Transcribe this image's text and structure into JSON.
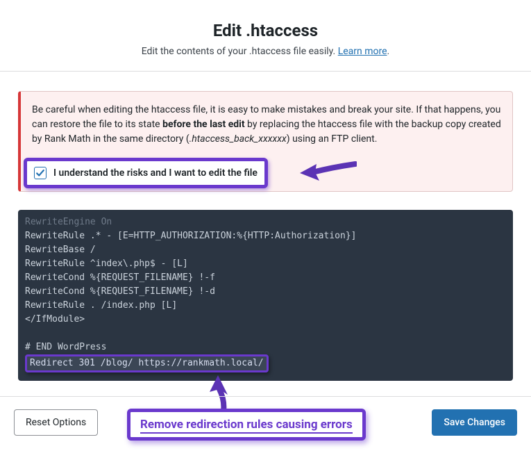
{
  "header": {
    "title": "Edit .htaccess",
    "subtitle": "Edit the contents of your .htaccess file easily. ",
    "learn_more": "Learn more",
    "period": "."
  },
  "warning": {
    "prefix": "Be careful when editing the htaccess file, it is easy to make mistakes and break your site. If that happens, you can restore the file to its state ",
    "bold": "before the last edit",
    "middle": " by replacing the htaccess file with the backup copy created by Rank Math in the same directory (",
    "backup": ".htaccess_back_xxxxxx",
    "suffix": ") using an FTP client."
  },
  "consent": {
    "label": "I understand the risks and I want to edit the file",
    "checked": true
  },
  "code": {
    "lines": [
      "RewriteEngine On",
      "RewriteRule .* - [E=HTTP_AUTHORIZATION:%{HTTP:Authorization}]",
      "RewriteBase /",
      "RewriteRule ^index\\.php$ - [L]",
      "RewriteCond %{REQUEST_FILENAME} !-f",
      "RewriteCond %{REQUEST_FILENAME} !-d",
      "RewriteRule . /index.php [L]",
      "</IfModule>",
      "",
      "# END WordPress"
    ],
    "last_line": "Redirect 301 /blog/ https://rankmath.local/"
  },
  "callout": {
    "text": "Remove redirection rules causing errors"
  },
  "footer": {
    "reset": "Reset Options",
    "save": "Save Changes"
  }
}
